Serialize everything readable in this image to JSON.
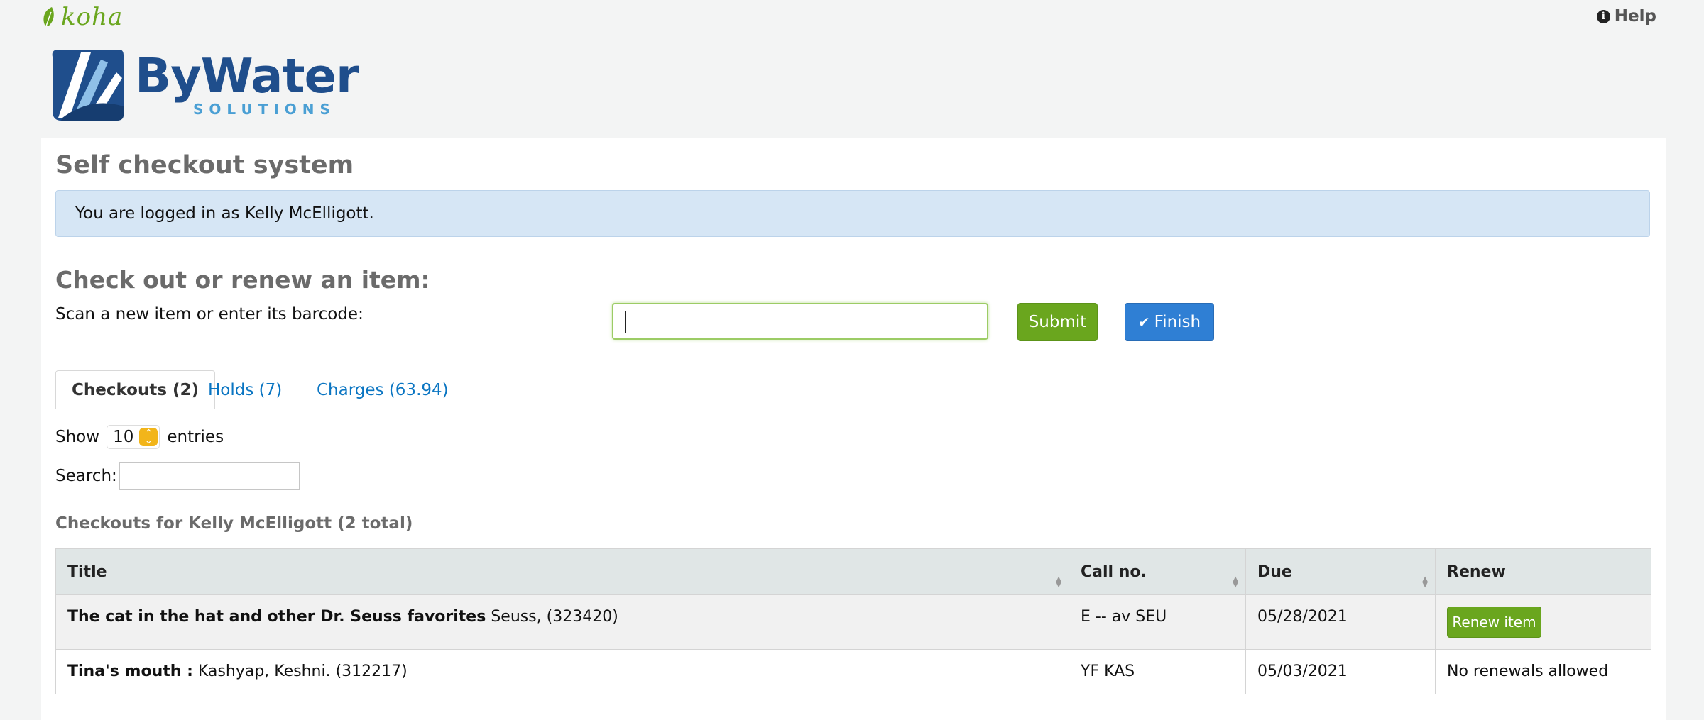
{
  "topbar": {
    "logo_text": "koha",
    "help_label": "Help"
  },
  "brand": {
    "name": "ByWater",
    "subtitle": "SOLUTIONS"
  },
  "page": {
    "title": "Self checkout system",
    "logged_in_message": "You are logged in as Kelly McElligott."
  },
  "checkout": {
    "section_title": "Check out or renew an item:",
    "scan_label": "Scan a new item or enter its barcode:",
    "barcode_value": "",
    "submit_label": "Submit",
    "finish_label": "Finish"
  },
  "tabs": [
    {
      "label": "Checkouts (2)",
      "active": true
    },
    {
      "label": "Holds (7)",
      "active": false
    },
    {
      "label": "Charges (63.94)",
      "active": false
    }
  ],
  "table_controls": {
    "show_label": "Show",
    "entries_value": "10",
    "entries_label": "entries",
    "search_label": "Search:"
  },
  "checkouts_table": {
    "caption": "Checkouts for Kelly McElligott (2 total)",
    "headers": [
      "Title",
      "Call no.",
      "Due",
      "Renew"
    ],
    "rows": [
      {
        "title": "The cat in the hat and other Dr. Seuss favorites",
        "author_info": "Seuss, (323420)",
        "call_no": "E -- av SEU",
        "due": "05/28/2021",
        "renew": "Renew item"
      },
      {
        "title": "Tina's mouth :",
        "author_info": "Kashyap, Keshni. (312217)",
        "call_no": "YF KAS",
        "due": "05/03/2021",
        "renew": "No renewals allowed"
      }
    ]
  },
  "colors": {
    "koha_green": "#6aa61e",
    "finish_blue": "#2f7fd4",
    "link_blue": "#0a75c2",
    "alert_bg": "#d6e6f5",
    "brand_navy": "#1f4e8c"
  }
}
